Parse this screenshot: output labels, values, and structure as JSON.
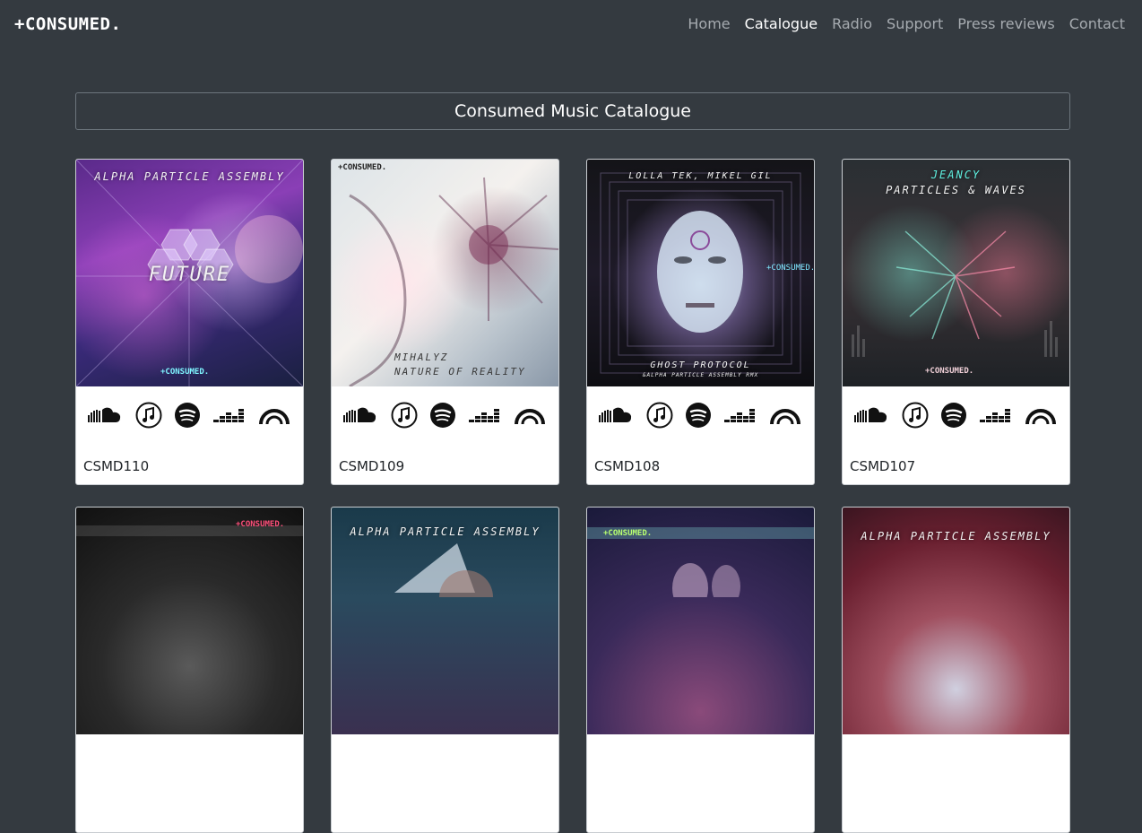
{
  "brand": "+CONSUMED.",
  "nav": [
    {
      "label": "Home"
    },
    {
      "label": "Catalogue"
    },
    {
      "label": "Radio"
    },
    {
      "label": "Support"
    },
    {
      "label": "Press reviews"
    },
    {
      "label": "Contact"
    }
  ],
  "active_nav": "Catalogue",
  "page_title": "Consumed Music Catalogue",
  "platform_icons": [
    "soundcloud-icon",
    "apple-music-icon",
    "spotify-icon",
    "deezer-icon",
    "beatport-icon"
  ],
  "releases": [
    {
      "catalog": "CSMD110",
      "artist": "ALPHA PARTICLE ASSEMBLY",
      "title": "FUTURE",
      "logo": "+CONSUMED."
    },
    {
      "catalog": "CSMD109",
      "artist": "MIHALYZ",
      "title": "NATURE OF REALITY",
      "logo": "+CONSUMED."
    },
    {
      "catalog": "CSMD108",
      "artist": "LOLLA TEK, MIKEL GIL",
      "title": "GHOST PROTOCOL",
      "subtitle": "&ALPHA PARTICLE ASSEMBLY RMX",
      "logo": "+CONSUMED."
    },
    {
      "catalog": "CSMD107",
      "artist": "JEANCY",
      "title": "PARTICLES & WAVES",
      "logo": "+CONSUMED."
    },
    {
      "logo": "+CONSUMED."
    },
    {
      "artist": "ALPHA PARTICLE ASSEMBLY"
    },
    {
      "logo": "+CONSUMED."
    },
    {
      "artist": "ALPHA PARTICLE ASSEMBLY"
    }
  ],
  "colors": {
    "background": "#343a40",
    "nav_inactive": "#a6abb0",
    "nav_active": "#ffffff",
    "card_bg": "#ffffff"
  }
}
